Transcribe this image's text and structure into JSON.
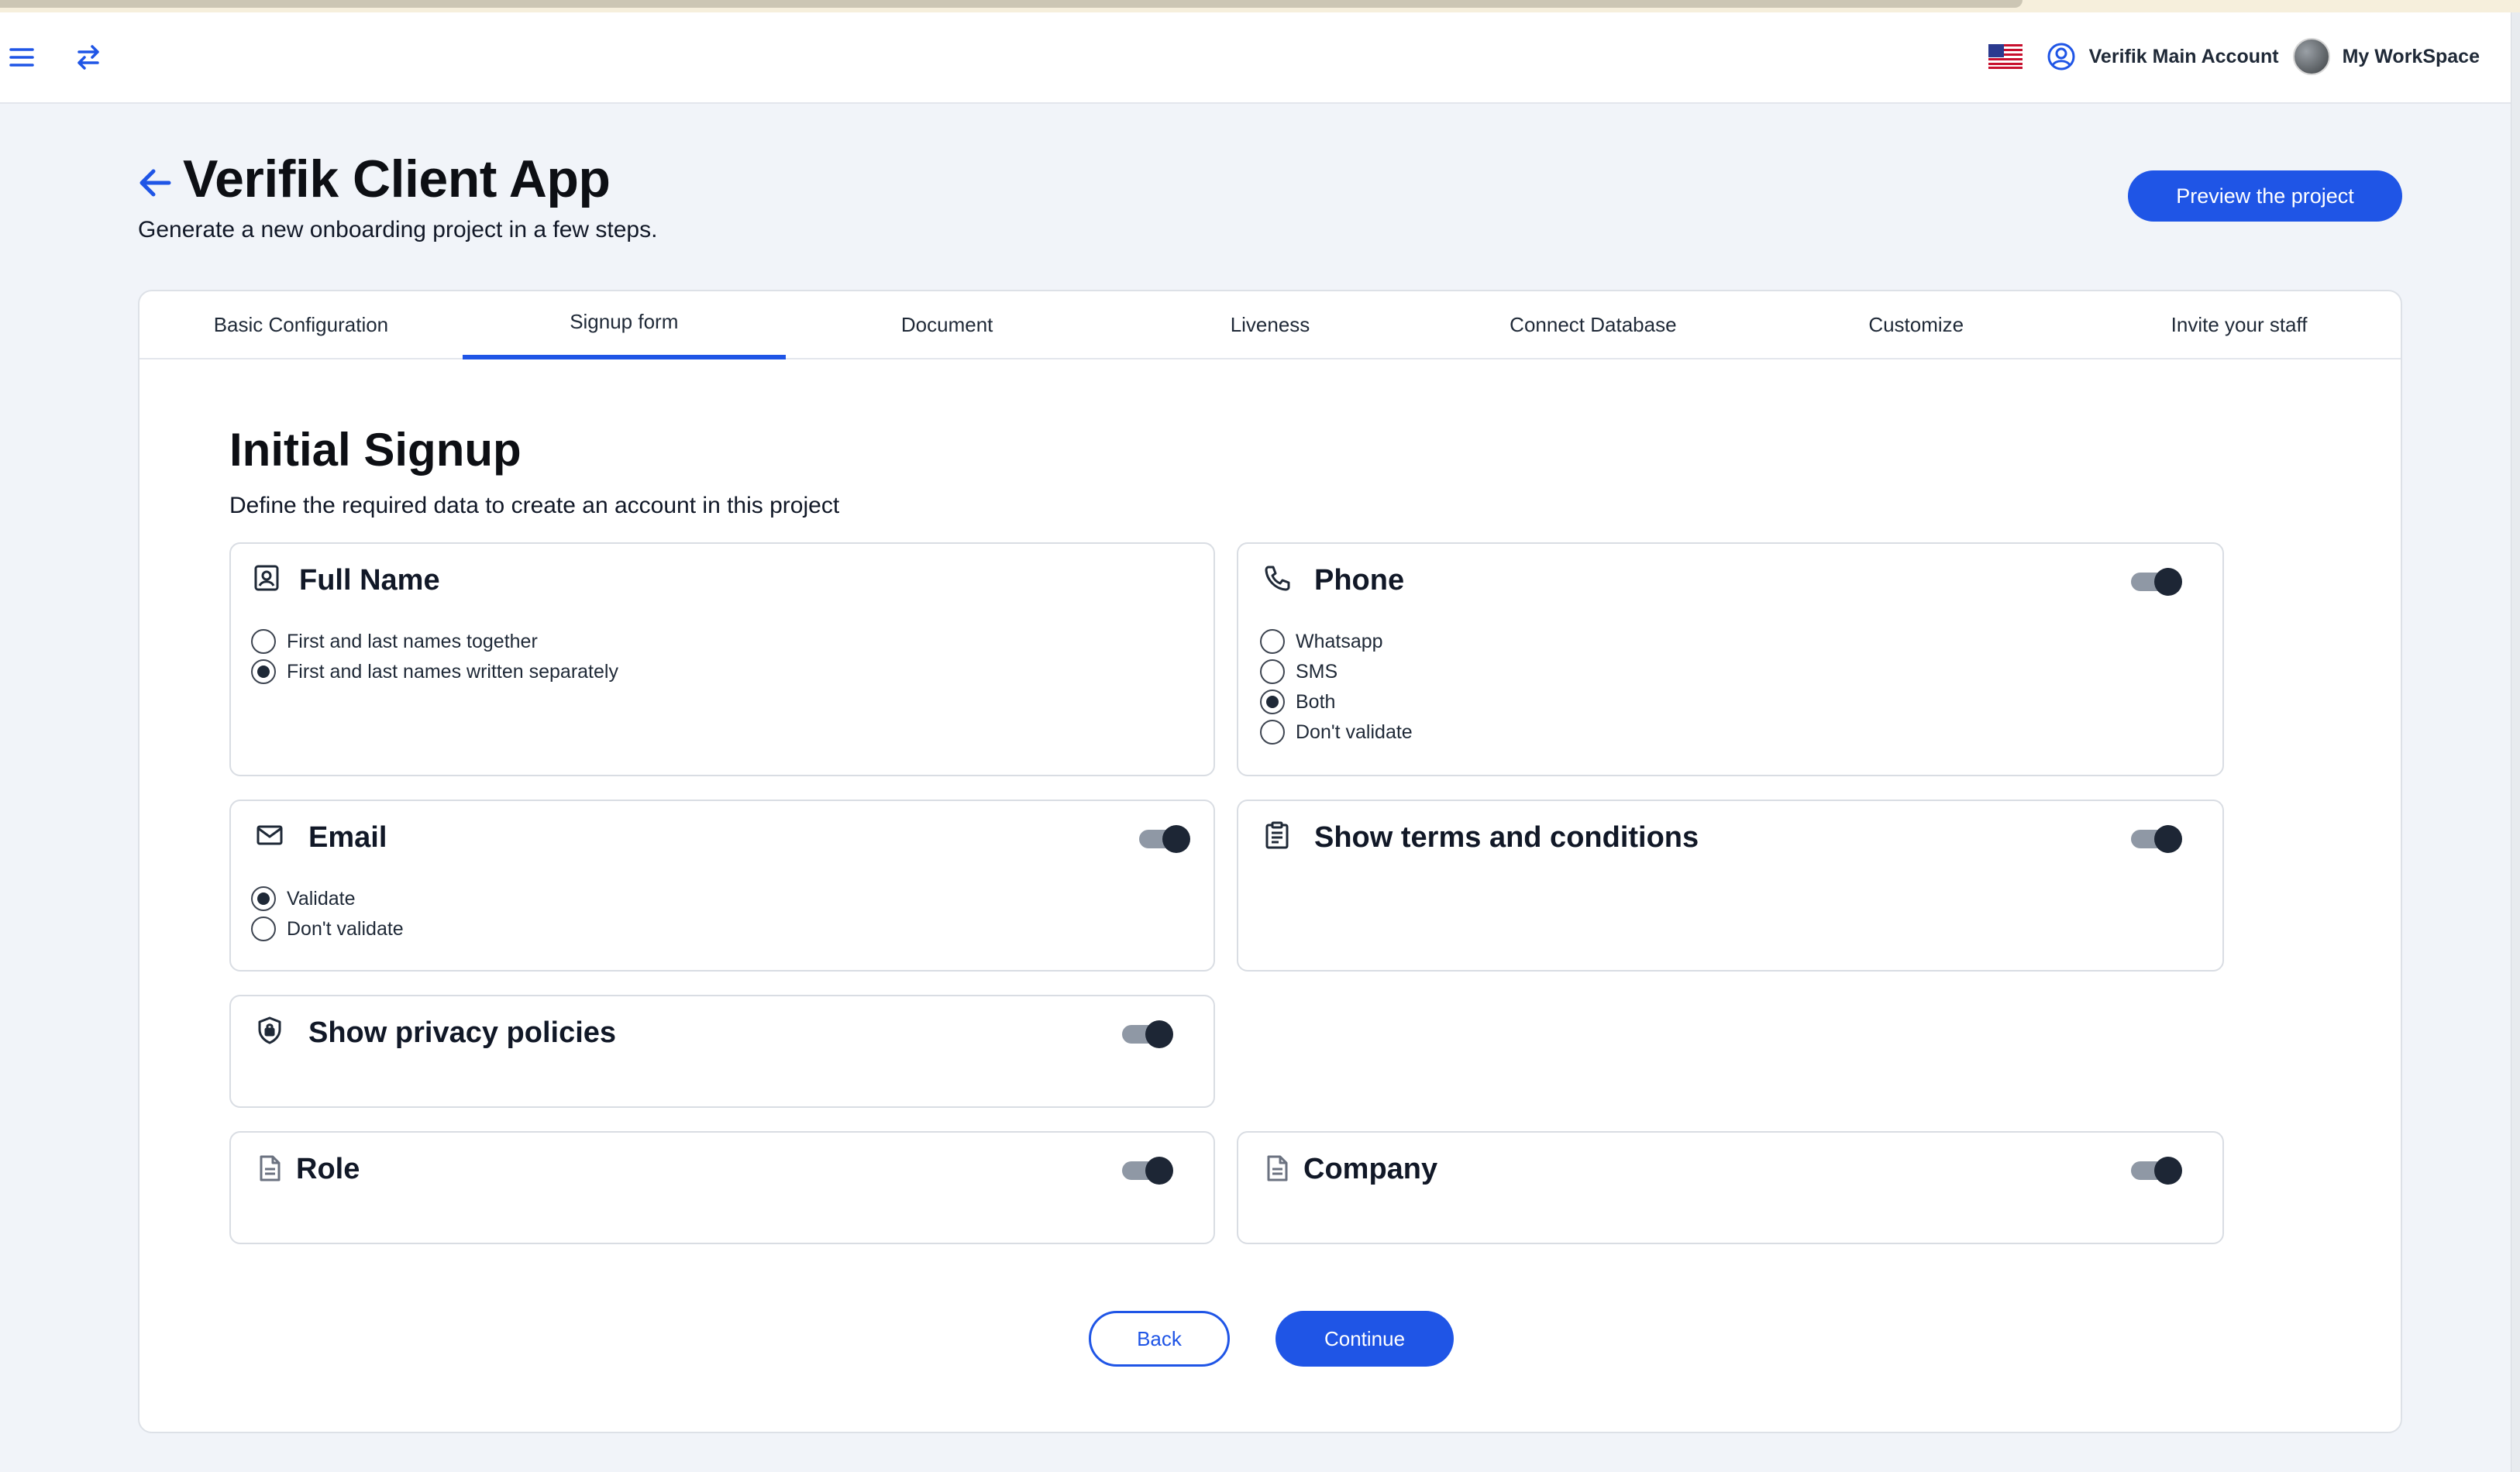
{
  "header": {
    "menu_icon": "hamburger-icon",
    "swap_icon": "swap-arrows-icon",
    "flag_icon": "us-flag-icon",
    "account_label": "Verifik Main Account",
    "workspace_label": "My WorkSpace"
  },
  "page": {
    "title": "Verifik Client App",
    "subtitle": "Generate a new onboarding project in a few steps.",
    "preview_button": "Preview the project"
  },
  "tabs": [
    {
      "label": "Basic Configuration"
    },
    {
      "label": "Signup form",
      "active": true
    },
    {
      "label": "Document"
    },
    {
      "label": "Liveness"
    },
    {
      "label": "Connect Database"
    },
    {
      "label": "Customize"
    },
    {
      "label": "Invite your staff"
    }
  ],
  "section": {
    "title": "Initial Signup",
    "subtitle": "Define the required data to create an account in this project"
  },
  "cards": {
    "full_name": {
      "title": "Full Name",
      "options": [
        "First and last names together",
        "First and last names written separately"
      ],
      "selected_index": 1
    },
    "phone": {
      "title": "Phone",
      "enabled": true,
      "options": [
        "Whatsapp",
        "SMS",
        "Both",
        "Don't validate"
      ],
      "selected_index": 2
    },
    "email": {
      "title": "Email",
      "enabled": true,
      "options": [
        "Validate",
        "Don't validate"
      ],
      "selected_index": 0
    },
    "terms": {
      "title": "Show terms and conditions",
      "enabled": true
    },
    "privacy": {
      "title": "Show privacy policies",
      "enabled": true
    },
    "role": {
      "title": "Role",
      "enabled": true
    },
    "company": {
      "title": "Company",
      "enabled": true
    }
  },
  "footer": {
    "back_label": "Back",
    "continue_label": "Continue"
  },
  "colors": {
    "accent": "#1f55e6",
    "background": "#f1f4f9",
    "toggle_track": "#8f98a5",
    "toggle_knob": "#1d2635"
  }
}
